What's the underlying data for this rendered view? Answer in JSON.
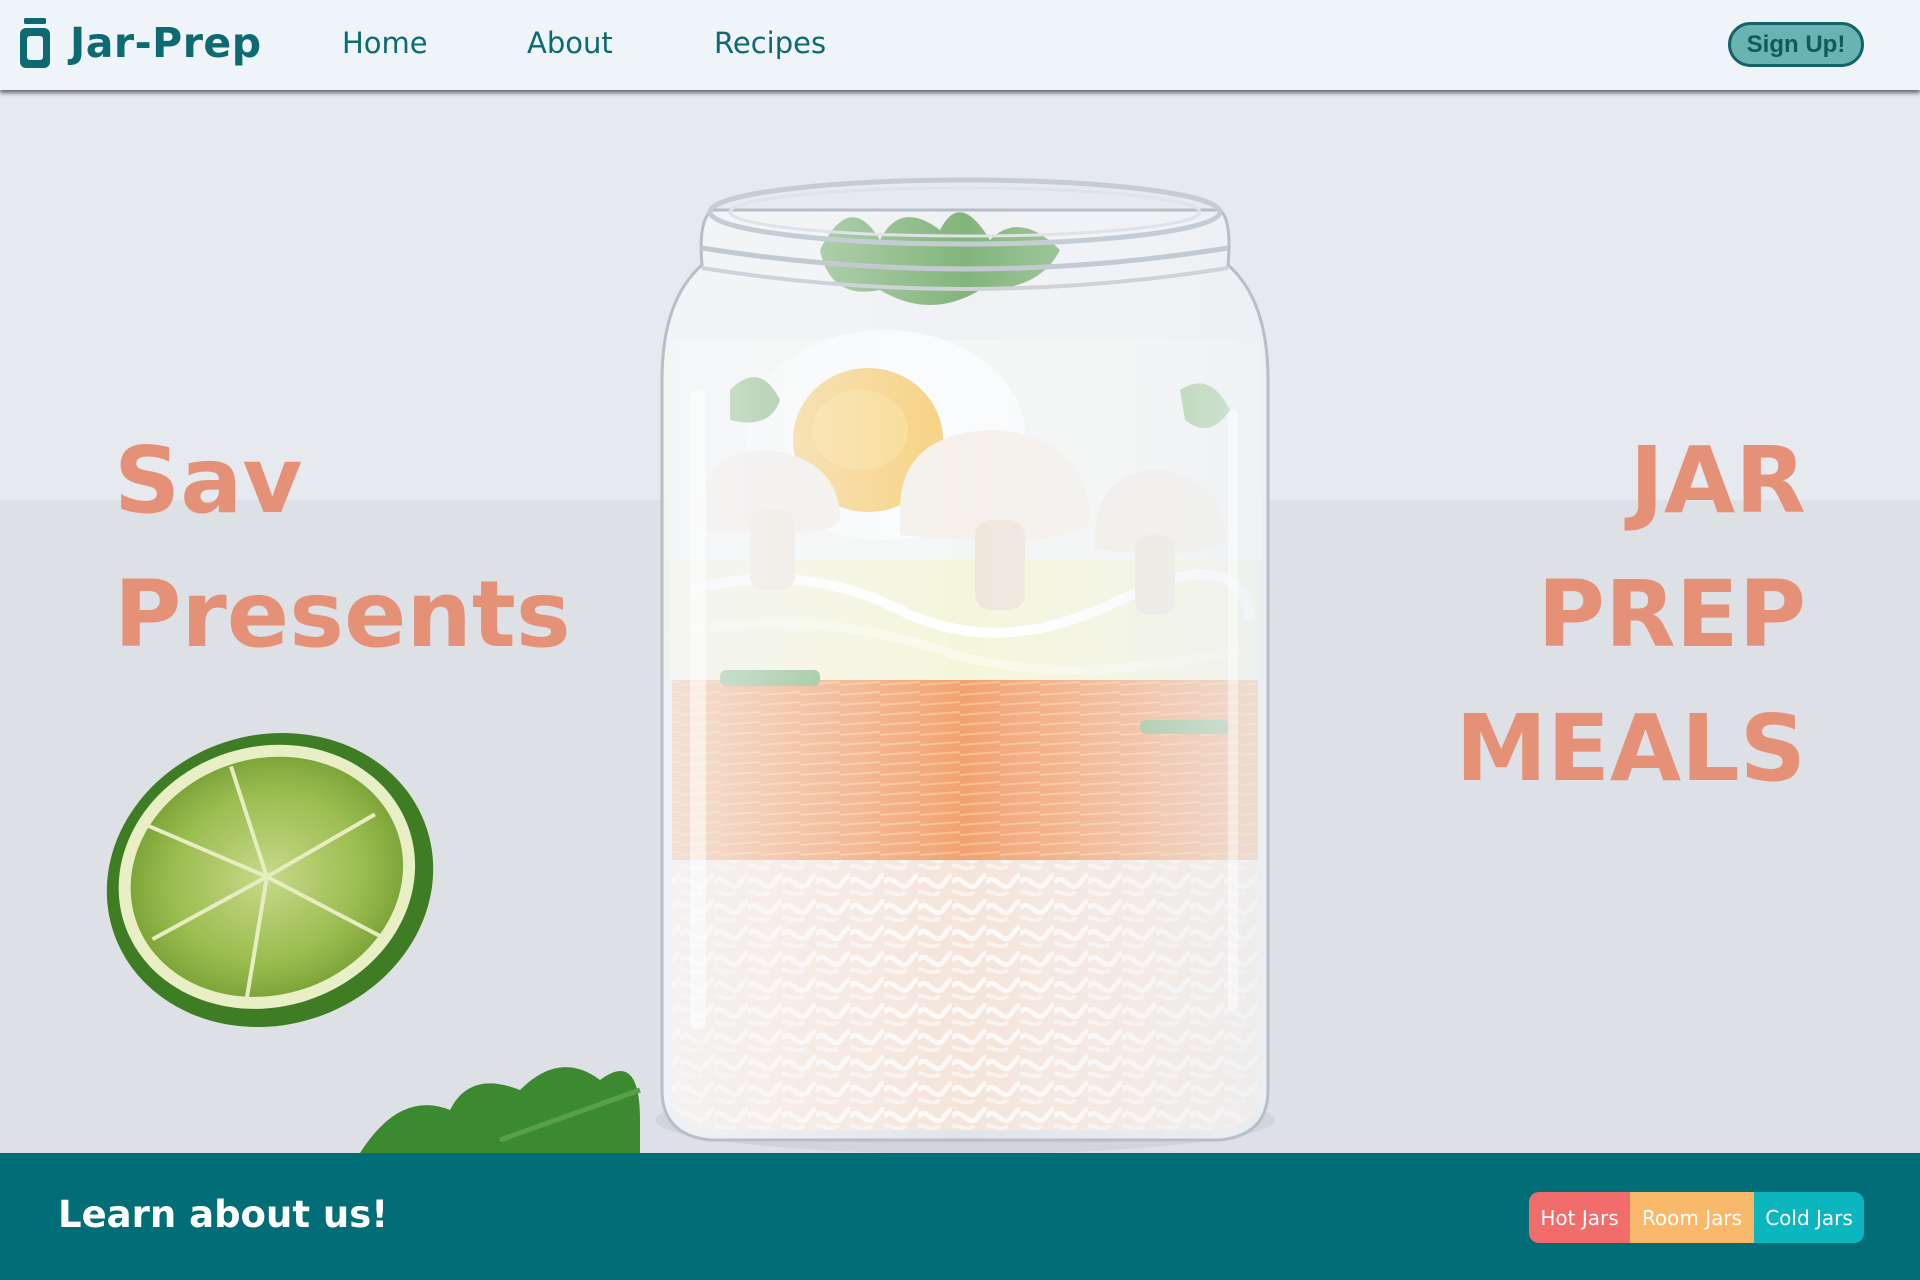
{
  "navbar": {
    "brand": "Jar-Prep",
    "brand_icon": "jar-icon",
    "links": [
      {
        "label": "Home"
      },
      {
        "label": "About"
      },
      {
        "label": "Recipes"
      }
    ],
    "signup_label": "Sign Up!"
  },
  "hero": {
    "left_lines": [
      "Sav",
      "Presents"
    ],
    "right_lines": [
      "JAR",
      "PREP",
      "MEALS"
    ],
    "text_color": "#e59178"
  },
  "footer": {
    "title": "Learn about us!",
    "pills": [
      {
        "label": "Hot Jars",
        "color": "#f16c6b"
      },
      {
        "label": "Room Jars",
        "color": "#f9b86a"
      },
      {
        "label": "Cold Jars",
        "color": "#0bb6bf"
      }
    ],
    "background": "#016e77"
  },
  "colors": {
    "brand": "#0d6a72",
    "nav_bg": "#eef4f8",
    "signup_bg": "#6ab3b3"
  }
}
